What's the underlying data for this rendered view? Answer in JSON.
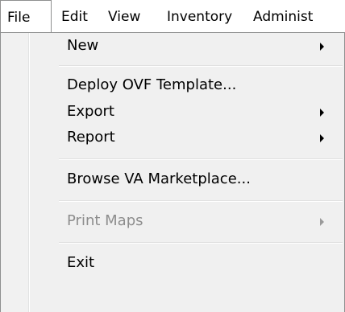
{
  "menubar": {
    "items": [
      {
        "label": "File"
      },
      {
        "label": "Edit"
      },
      {
        "label": "View"
      },
      {
        "label": "Inventory"
      },
      {
        "label": "Administ"
      }
    ]
  },
  "file_menu": {
    "items": [
      {
        "label": "New",
        "submenu": true,
        "enabled": true
      },
      {
        "label": "Deploy OVF Template...",
        "submenu": false,
        "enabled": true
      },
      {
        "label": "Export",
        "submenu": true,
        "enabled": true
      },
      {
        "label": "Report",
        "submenu": true,
        "enabled": true
      },
      {
        "label": "Browse VA Marketplace...",
        "submenu": false,
        "enabled": true
      },
      {
        "label": "Print Maps",
        "submenu": true,
        "enabled": false
      },
      {
        "label": "Exit",
        "submenu": false,
        "enabled": true
      }
    ]
  },
  "icons": {
    "submenu_arrow": "chevron-right-icon"
  },
  "colors": {
    "border": "#8e8f8f",
    "menu_background": "#f0f0f0",
    "disabled_text": "#8d8d8d"
  }
}
